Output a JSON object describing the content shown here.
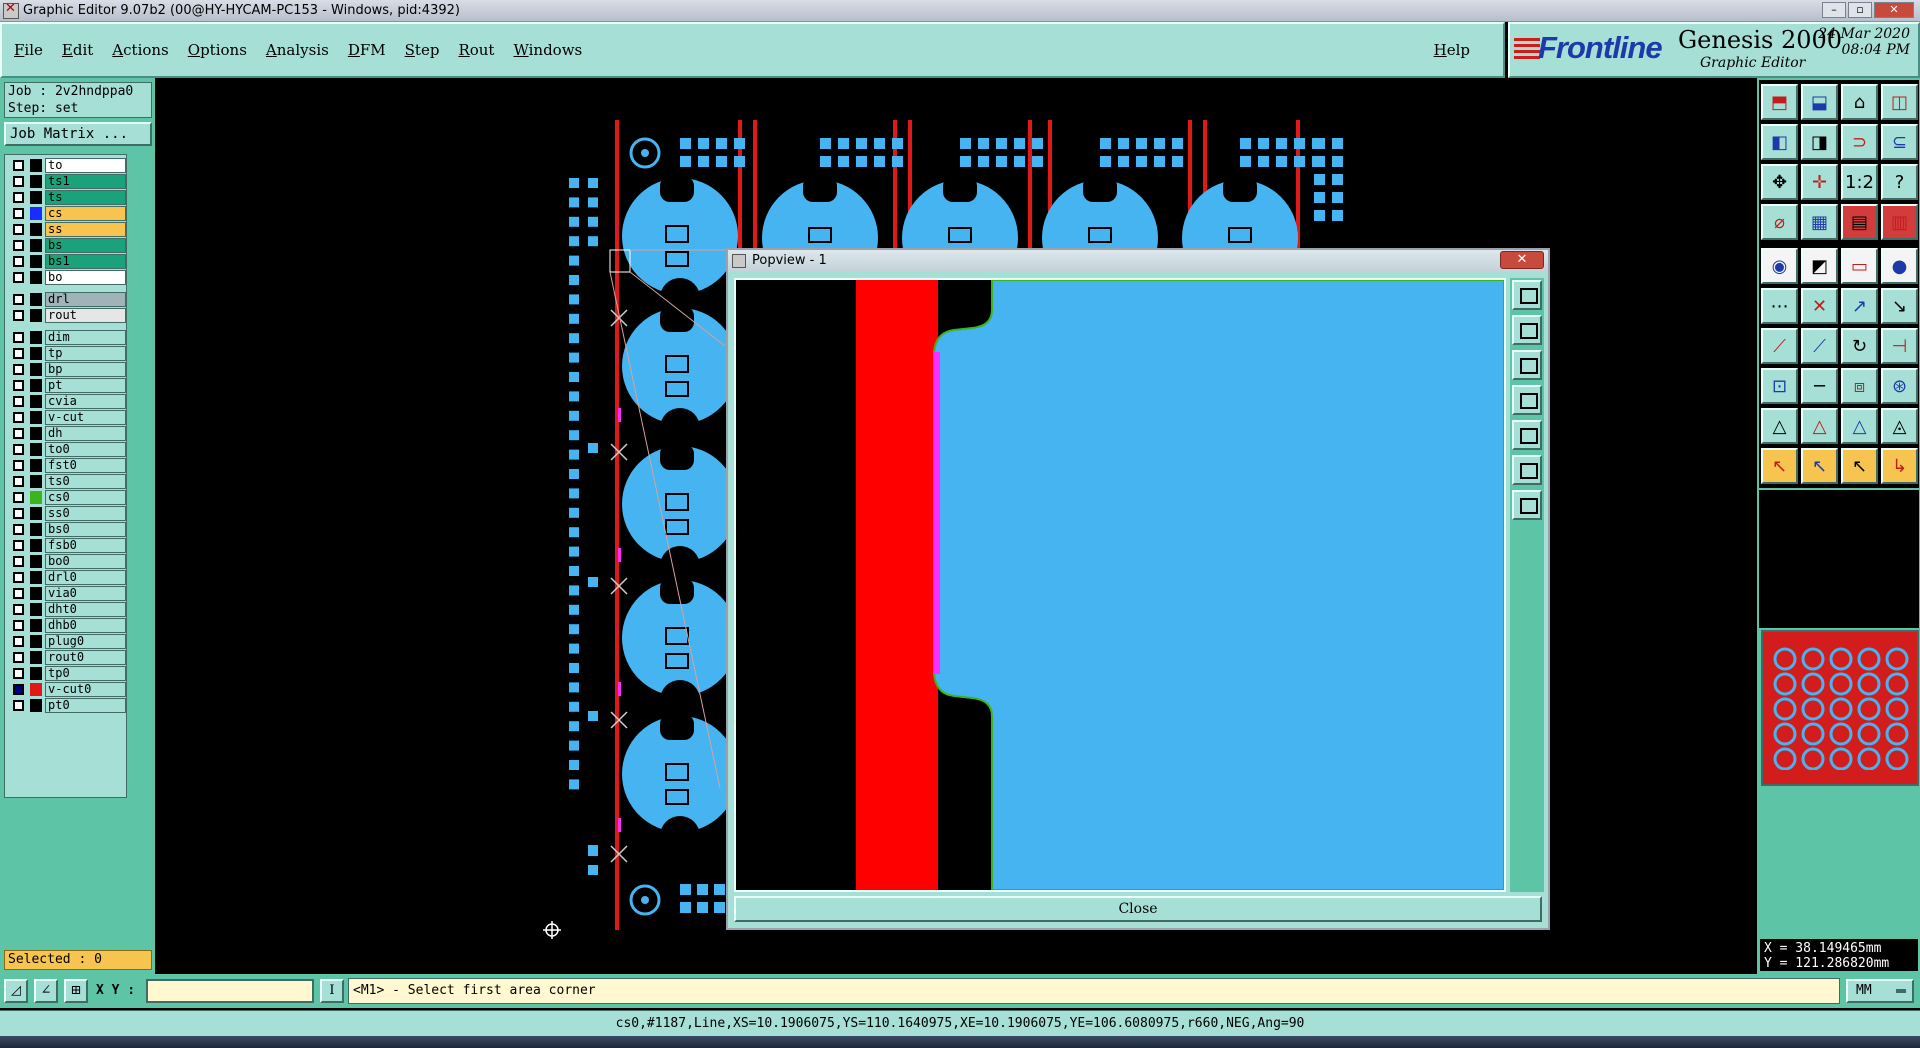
{
  "window": {
    "title": "Graphic Editor 9.07b2 (00@HY-HYCAM-PC153 - Windows, pid:4392)"
  },
  "menu": {
    "items": [
      "File",
      "Edit",
      "Actions",
      "Options",
      "Analysis",
      "DFM",
      "Step",
      "Rout",
      "Windows"
    ],
    "help": "Help"
  },
  "branding": {
    "logo": "Frontline",
    "product": "Genesis 2000",
    "subtitle": "Graphic Editor",
    "date": "24 Mar 2020",
    "time": "08:04 PM"
  },
  "job": {
    "job_line": "Job : 2v2hndppa0",
    "step_line": "Step: set",
    "matrix_button": "Job Matrix ..."
  },
  "layers": [
    {
      "name": "to",
      "color": "#ffffff",
      "swatch": "#000000"
    },
    {
      "name": "ts1",
      "color": "#1aa37a",
      "swatch": "#000000"
    },
    {
      "name": "ts",
      "color": "#1aa37a",
      "swatch": "#000000"
    },
    {
      "name": "cs",
      "color": "#f7c450",
      "swatch": "#1a2cff"
    },
    {
      "name": "ss",
      "color": "#f7c450",
      "swatch": "#000000"
    },
    {
      "name": "bs",
      "color": "#1aa37a",
      "swatch": "#000000"
    },
    {
      "name": "bs1",
      "color": "#1aa37a",
      "swatch": "#000000"
    },
    {
      "name": "bo",
      "color": "#ffffff",
      "swatch": "#000000"
    },
    {
      "name": "drl",
      "color": "#9fb3b8",
      "swatch": "#000000",
      "gap": true
    },
    {
      "name": "rout",
      "color": "#e6e6e6",
      "swatch": "#000000"
    },
    {
      "name": "dim",
      "color": "#a6dfd6",
      "swatch": "#000000",
      "gap": true
    },
    {
      "name": "tp",
      "color": "#a6dfd6",
      "swatch": "#000000"
    },
    {
      "name": "bp",
      "color": "#a6dfd6",
      "swatch": "#000000"
    },
    {
      "name": "pt",
      "color": "#a6dfd6",
      "swatch": "#000000"
    },
    {
      "name": "cvia",
      "color": "#a6dfd6",
      "swatch": "#000000"
    },
    {
      "name": "v-cut",
      "color": "#a6dfd6",
      "swatch": "#000000"
    },
    {
      "name": "dh",
      "color": "#a6dfd6",
      "swatch": "#000000"
    },
    {
      "name": "to0",
      "color": "#a6dfd6",
      "swatch": "#000000"
    },
    {
      "name": "fst0",
      "color": "#a6dfd6",
      "swatch": "#000000"
    },
    {
      "name": "ts0",
      "color": "#a6dfd6",
      "swatch": "#000000"
    },
    {
      "name": "cs0",
      "color": "#a6dfd6",
      "swatch": "#3cb41e"
    },
    {
      "name": "ss0",
      "color": "#a6dfd6",
      "swatch": "#000000"
    },
    {
      "name": "bs0",
      "color": "#a6dfd6",
      "swatch": "#000000"
    },
    {
      "name": "fsb0",
      "color": "#a6dfd6",
      "swatch": "#000000"
    },
    {
      "name": "bo0",
      "color": "#a6dfd6",
      "swatch": "#000000"
    },
    {
      "name": "drl0",
      "color": "#a6dfd6",
      "swatch": "#000000"
    },
    {
      "name": "via0",
      "color": "#a6dfd6",
      "swatch": "#000000"
    },
    {
      "name": "dht0",
      "color": "#a6dfd6",
      "swatch": "#000000"
    },
    {
      "name": "dhb0",
      "color": "#a6dfd6",
      "swatch": "#000000"
    },
    {
      "name": "plug0",
      "color": "#a6dfd6",
      "swatch": "#000000"
    },
    {
      "name": "rout0",
      "color": "#a6dfd6",
      "swatch": "#000000"
    },
    {
      "name": "tp0",
      "color": "#a6dfd6",
      "swatch": "#000000"
    },
    {
      "name": "v-cut0",
      "color": "#a6dfd6",
      "swatch": "#e01818",
      "checked": true
    },
    {
      "name": "pt0",
      "color": "#a6dfd6",
      "swatch": "#000000"
    }
  ],
  "selected": "Selected : 0",
  "popview": {
    "title": "Popview - 1",
    "close_x": "✕",
    "close_button": "Close"
  },
  "toolbox": {
    "icons": [
      "page-up-icon",
      "page-down-icon",
      "home-icon",
      "split-view-icon",
      "pan-left-icon",
      "pan-right-icon",
      "zoom-toggle-icon",
      "snap-icon",
      "fit-screen-icon",
      "center-icon",
      "ratio-icon",
      "help-icon",
      "attach-icon",
      "grid-icon",
      "layer-up-icon",
      "layer-down-icon",
      "pad-icon",
      "line-icon",
      "measure-icon",
      "dot-icon",
      "connect-icon",
      "cross-icon",
      "move-icon",
      "copy-icon",
      "arc-icon",
      "draw-icon",
      "rotate-icon",
      "mirror-icon",
      "place-icon",
      "dash-icon",
      "resize-icon",
      "group-icon",
      "triangle-icon",
      "text-a-icon",
      "outline-a-icon",
      "hatch-icon",
      "select-icon",
      "select-add-icon",
      "select-remove-icon",
      "select-route-icon"
    ],
    "ratio_label": "1:2",
    "help_label": "?"
  },
  "coords": {
    "x": "X = 38.149465mm",
    "y": "Y = 121.286820mm"
  },
  "command": {
    "xy_label": "X Y :",
    "xy_value": "",
    "prompt": "<M1> - Select first area corner",
    "units": "MM"
  },
  "status": "cs0,#1187,Line,XS=10.1906075,YS=110.1640975,XE=10.1906075,YE=106.6080975,r660,NEG,Ang=90",
  "colors": {
    "panel": "#a6dfd6",
    "panel_dark": "#5ec4a6",
    "copper": "#46b4f0",
    "outline": "#e01818",
    "highlight": "#ff2cff"
  }
}
